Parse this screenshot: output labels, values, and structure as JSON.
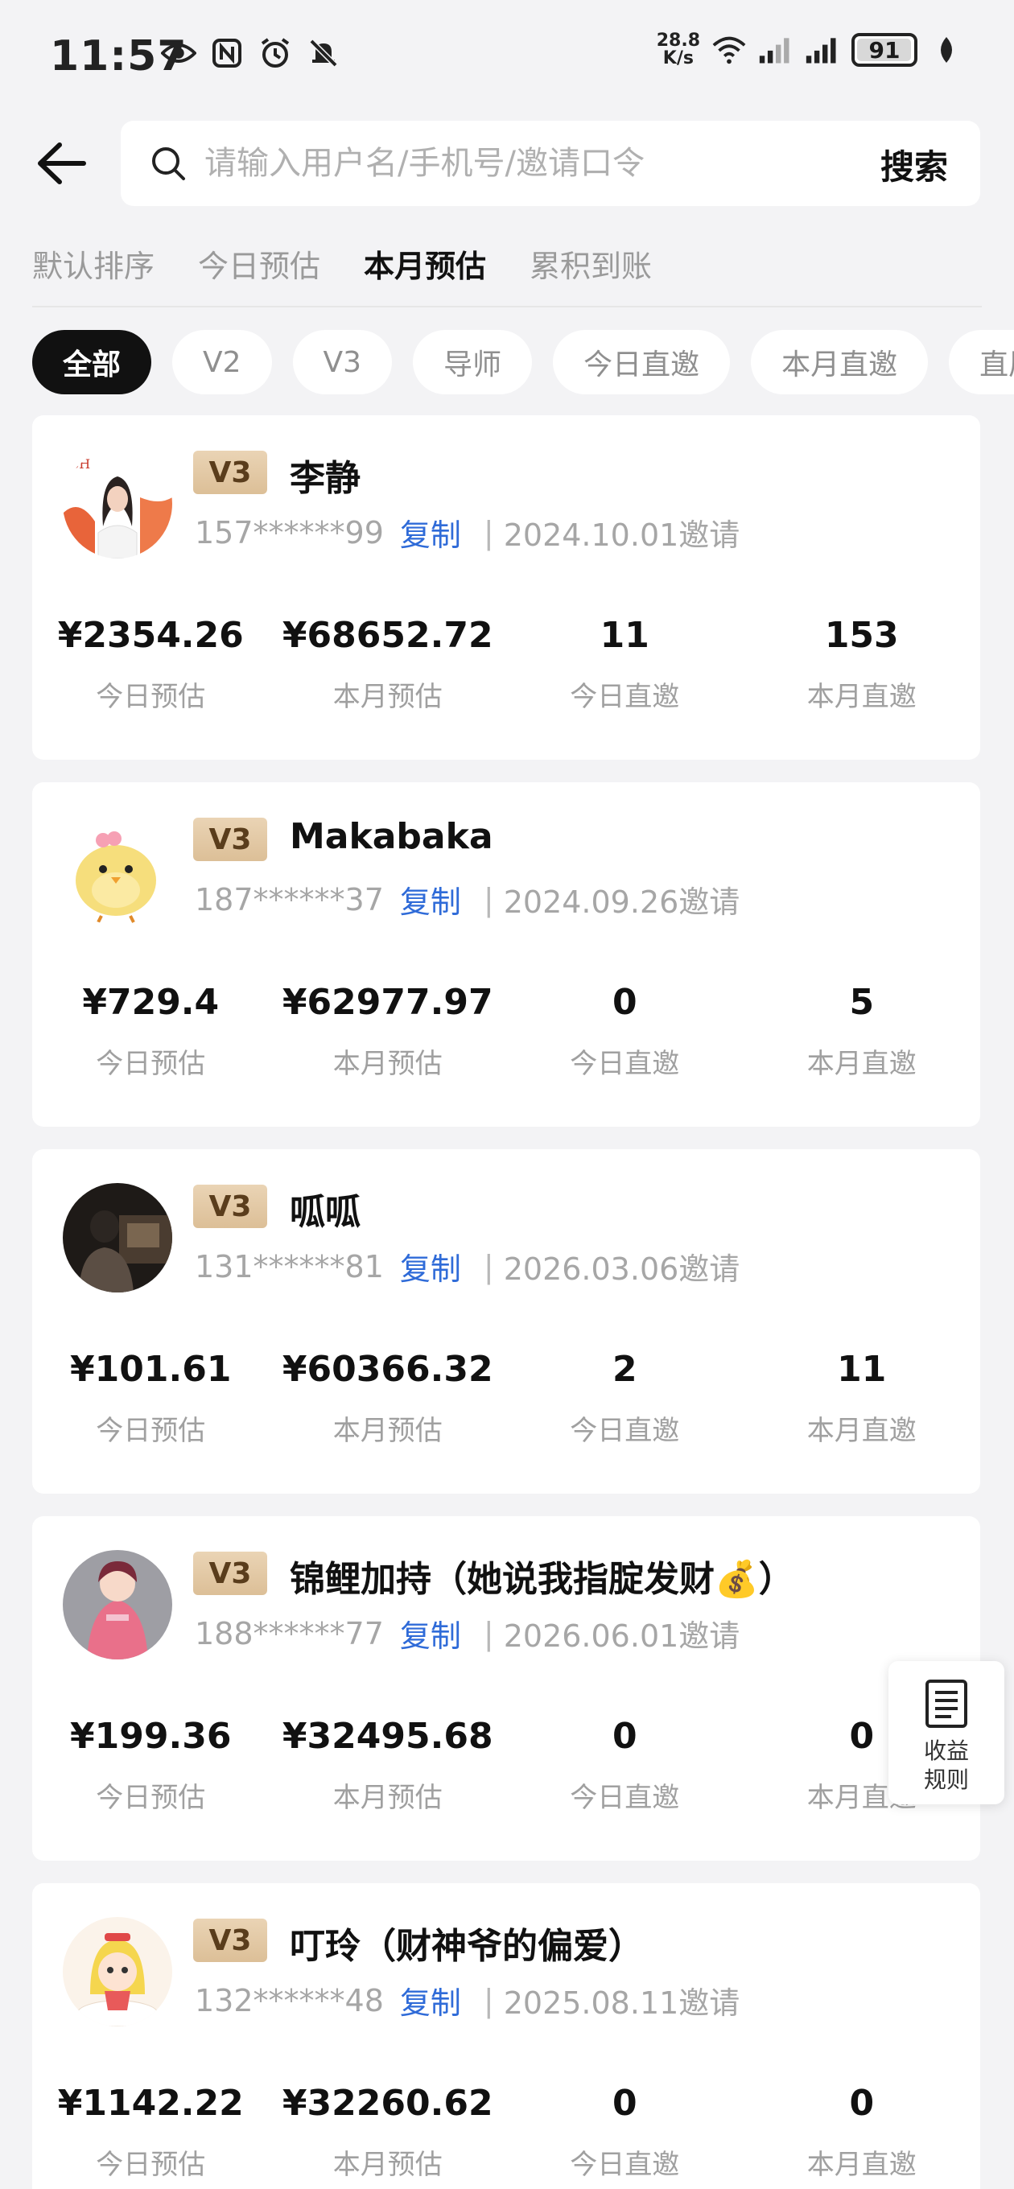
{
  "status_bar": {
    "time": "11:57",
    "net_speed_value": "28.8",
    "net_speed_unit": "K/s",
    "battery": "91",
    "icons": [
      "eye-icon",
      "nfc-icon",
      "alarm-icon",
      "mute-icon",
      "wifi-icon",
      "signal-icon",
      "signal-icon",
      "leaf-icon"
    ]
  },
  "header": {
    "search_placeholder": "请输入用户名/手机号/邀请口令",
    "search_button": "搜索"
  },
  "sort_tabs": [
    {
      "label": "默认排序",
      "active": false
    },
    {
      "label": "今日预估",
      "active": false
    },
    {
      "label": "本月预估",
      "active": true
    },
    {
      "label": "累积到账",
      "active": false
    }
  ],
  "filter_chips": [
    {
      "label": "全部",
      "active": true
    },
    {
      "label": "V2",
      "active": false
    },
    {
      "label": "V3",
      "active": false
    },
    {
      "label": "导师",
      "active": false
    },
    {
      "label": "今日直邀",
      "active": false
    },
    {
      "label": "本月直邀",
      "active": false
    },
    {
      "label": "直属",
      "active": false
    }
  ],
  "stat_labels": {
    "today_estimate": "今日预估",
    "month_estimate": "本月预估",
    "today_invites": "今日直邀",
    "month_invites": "本月直邀"
  },
  "users": [
    {
      "level": "V3",
      "name": "李静",
      "phone": "157******99",
      "copy": "复制",
      "invite_date": "2024.10.01邀请",
      "today_estimate": "¥2354.26",
      "month_estimate": "¥68652.72",
      "today_invites": "11",
      "month_invites": "153"
    },
    {
      "level": "V3",
      "name": "Makabaka",
      "phone": "187******37",
      "copy": "复制",
      "invite_date": "2024.09.26邀请",
      "today_estimate": "¥729.4",
      "month_estimate": "¥62977.97",
      "today_invites": "0",
      "month_invites": "5"
    },
    {
      "level": "V3",
      "name": "呱呱",
      "phone": "131******81",
      "copy": "复制",
      "invite_date": "2026.03.06邀请",
      "today_estimate": "¥101.61",
      "month_estimate": "¥60366.32",
      "today_invites": "2",
      "month_invites": "11"
    },
    {
      "level": "V3",
      "name": "锦鲤加持（她说我指腚发财💰）",
      "phone": "188******77",
      "copy": "复制",
      "invite_date": "2026.06.01邀请",
      "today_estimate": "¥199.36",
      "month_estimate": "¥32495.68",
      "today_invites": "0",
      "month_invites": "0"
    },
    {
      "level": "V3",
      "name": "叮玲（财神爷的偏爱）",
      "phone": "132******48",
      "copy": "复制",
      "invite_date": "2025.08.11邀请",
      "today_estimate": "¥1142.22",
      "month_estimate": "¥32260.62",
      "today_invites": "0",
      "month_invites": "0"
    }
  ],
  "rules_button": {
    "label": "收益规则"
  }
}
